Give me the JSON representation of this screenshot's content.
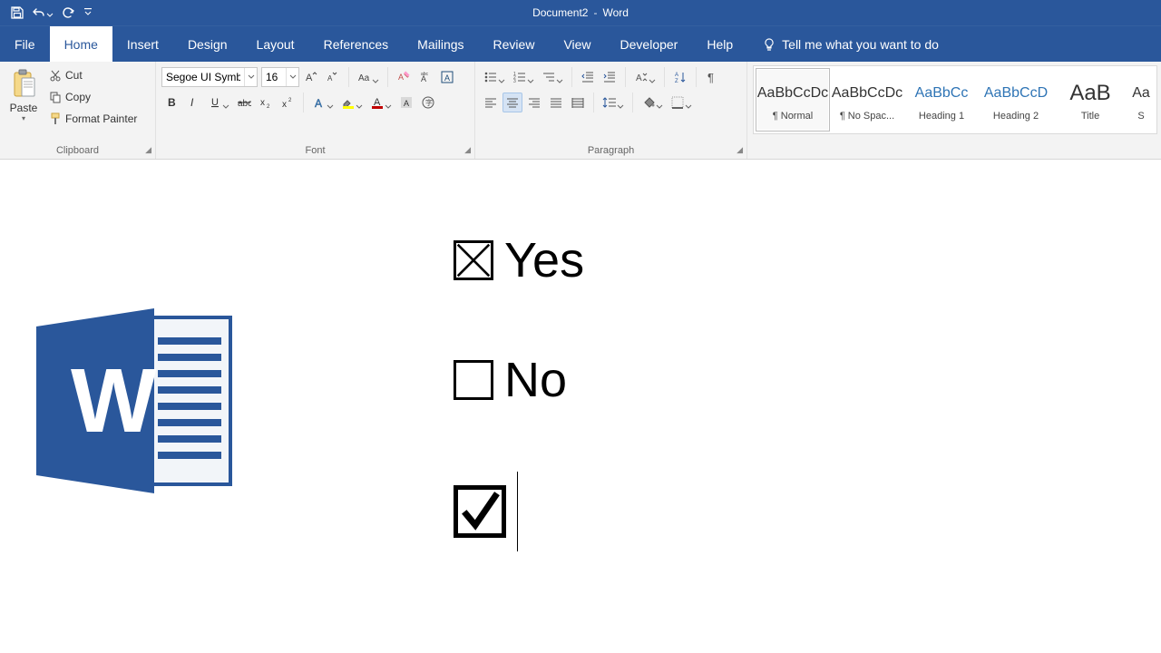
{
  "title": {
    "doc": "Document2",
    "app": "Word"
  },
  "qat": {
    "save": "save",
    "undo": "undo",
    "redo": "redo"
  },
  "tabs": [
    "File",
    "Home",
    "Insert",
    "Design",
    "Layout",
    "References",
    "Mailings",
    "Review",
    "View",
    "Developer",
    "Help"
  ],
  "active_tab": "Home",
  "tell_me": "Tell me what you want to do",
  "clipboard": {
    "paste": "Paste",
    "cut": "Cut",
    "copy": "Copy",
    "format_painter": "Format Painter",
    "group_label": "Clipboard"
  },
  "font": {
    "name": "Segoe UI Symb",
    "size": "16",
    "group_label": "Font"
  },
  "paragraph": {
    "group_label": "Paragraph"
  },
  "styles": [
    {
      "preview": "AaBbCcDc",
      "name": "¶ Normal",
      "class": "normal",
      "selected": true
    },
    {
      "preview": "AaBbCcDc",
      "name": "¶ No Spac...",
      "class": "normal",
      "selected": false
    },
    {
      "preview": "AaBbCc",
      "name": "Heading 1",
      "class": "heading",
      "selected": false
    },
    {
      "preview": "AaBbCcD",
      "name": "Heading 2",
      "class": "heading",
      "selected": false
    },
    {
      "preview": "AaB",
      "name": "Title",
      "class": "title",
      "selected": false
    },
    {
      "preview": "Aa",
      "name": "S",
      "class": "normal",
      "selected": false
    }
  ],
  "document": {
    "line1": "Yes",
    "line2": "No"
  }
}
